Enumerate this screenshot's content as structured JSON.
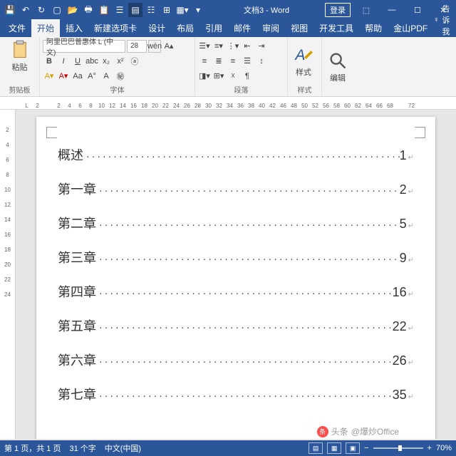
{
  "window": {
    "doc_name": "文档3",
    "app_suffix": " - Word",
    "login": "登录",
    "qat_sep": "▾"
  },
  "tabs": {
    "items": [
      "文件",
      "开始",
      "插入",
      "新建选项卡",
      "设计",
      "布局",
      "引用",
      "邮件",
      "审阅",
      "视图",
      "开发工具",
      "帮助",
      "金山PDF"
    ],
    "active_idx": 1,
    "tell_me_icon": "♀",
    "tell_me": "告诉我",
    "share": "共享"
  },
  "ribbon": {
    "clipboard": {
      "paste": "粘贴",
      "label": "剪贴板"
    },
    "font": {
      "name": "阿里巴巴普惠体 L (中文)",
      "size": "28",
      "label": "字体"
    },
    "paragraph": {
      "label": "段落"
    },
    "styles": {
      "label": "样式",
      "btn": "样式"
    },
    "editing": {
      "label": "",
      "btn": "编辑"
    }
  },
  "ruler": {
    "h": [
      "L",
      "2",
      "",
      "2",
      "4",
      "6",
      "8",
      "10",
      "12",
      "14",
      "16",
      "18",
      "20",
      "22",
      "24",
      "26",
      "28",
      "30",
      "32",
      "34",
      "36",
      "38",
      "40",
      "42",
      "46",
      "48",
      "50",
      "52",
      "56",
      "58",
      "60",
      "62",
      "64",
      "66",
      "68",
      "",
      "72"
    ],
    "v": [
      "",
      "2",
      "4",
      "6",
      "8",
      "10",
      "12",
      "14",
      "16",
      "18",
      "20",
      "22",
      "24"
    ]
  },
  "toc": [
    {
      "title": "概述",
      "page": "1"
    },
    {
      "title": "第一章",
      "page": "2"
    },
    {
      "title": "第二章",
      "page": "5"
    },
    {
      "title": "第三章",
      "page": "9"
    },
    {
      "title": "第四章",
      "page": "16"
    },
    {
      "title": "第五章",
      "page": "22"
    },
    {
      "title": "第六章",
      "page": "26"
    },
    {
      "title": "第七章",
      "page": "35"
    }
  ],
  "status": {
    "page": "第 1 页，共 1 页",
    "words": "31 个字",
    "lang": "中文(中国)",
    "zoom": "70%"
  },
  "watermark": {
    "prefix": "头条",
    "handle": "@爆炒Office"
  }
}
